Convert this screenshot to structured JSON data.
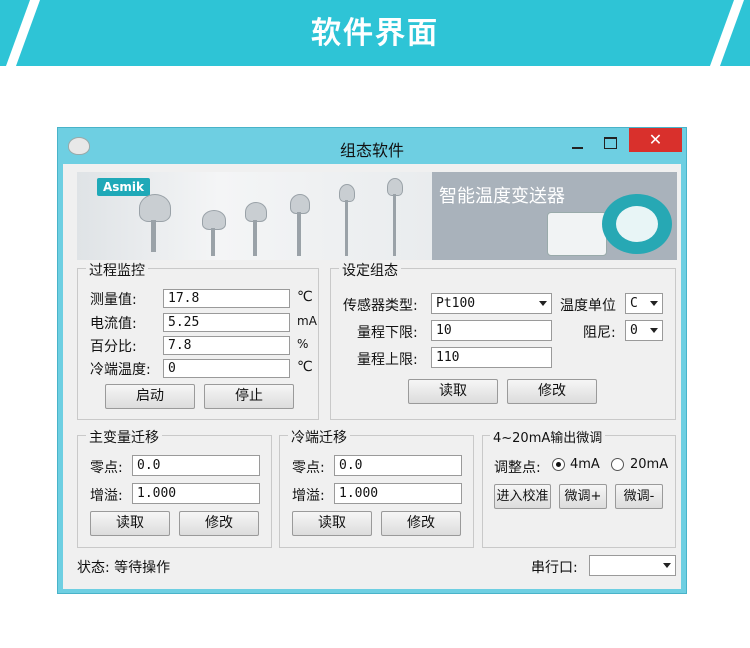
{
  "banner": {
    "title": "软件界面"
  },
  "window": {
    "title": "组态软件",
    "close_label": "✕"
  },
  "product_image": {
    "brand": "Asmik",
    "slogan": "智能温度变送器"
  },
  "process_monitor": {
    "title": "过程监控",
    "rows": [
      {
        "label": "测量值:",
        "value": "17.8",
        "unit": "℃"
      },
      {
        "label": "电流值:",
        "value": "5.25",
        "unit": "mA"
      },
      {
        "label": "百分比:",
        "value": "7.8",
        "unit": "%"
      },
      {
        "label": "冷端温度:",
        "value": "0",
        "unit": "℃"
      }
    ],
    "start_label": "启动",
    "stop_label": "停止"
  },
  "settings": {
    "title": "设定组态",
    "sensor_type_label": "传感器类型:",
    "sensor_type_value": "Pt100",
    "temp_unit_label": "温度单位",
    "temp_unit_value": "C",
    "range_low_label": "量程下限:",
    "range_low_value": "10",
    "damping_label": "阻尼:",
    "damping_value": "0",
    "range_high_label": "量程上限:",
    "range_high_value": "110",
    "read_label": "读取",
    "modify_label": "修改"
  },
  "main_var_migration": {
    "title": "主变量迁移",
    "zero_label": "零点:",
    "zero_value": "0.0",
    "gain_label": "增溢:",
    "gain_value": "1.000",
    "read_label": "读取",
    "modify_label": "修改"
  },
  "cold_end_migration": {
    "title": "冷端迁移",
    "zero_label": "零点:",
    "zero_value": "0.0",
    "gain_label": "增溢:",
    "gain_value": "1.000",
    "read_label": "读取",
    "modify_label": "修改"
  },
  "output_trim": {
    "title": "4~20mA输出微调",
    "adjust_label": "调整点:",
    "option_4ma": "4mA",
    "option_20ma": "20mA",
    "selected": "4mA",
    "enter_calib_label": "进入校准",
    "trim_up_label": "微调+",
    "trim_down_label": "微调-"
  },
  "status": {
    "text": "状态: 等待操作",
    "serial_label": "串行口:",
    "serial_value": ""
  }
}
